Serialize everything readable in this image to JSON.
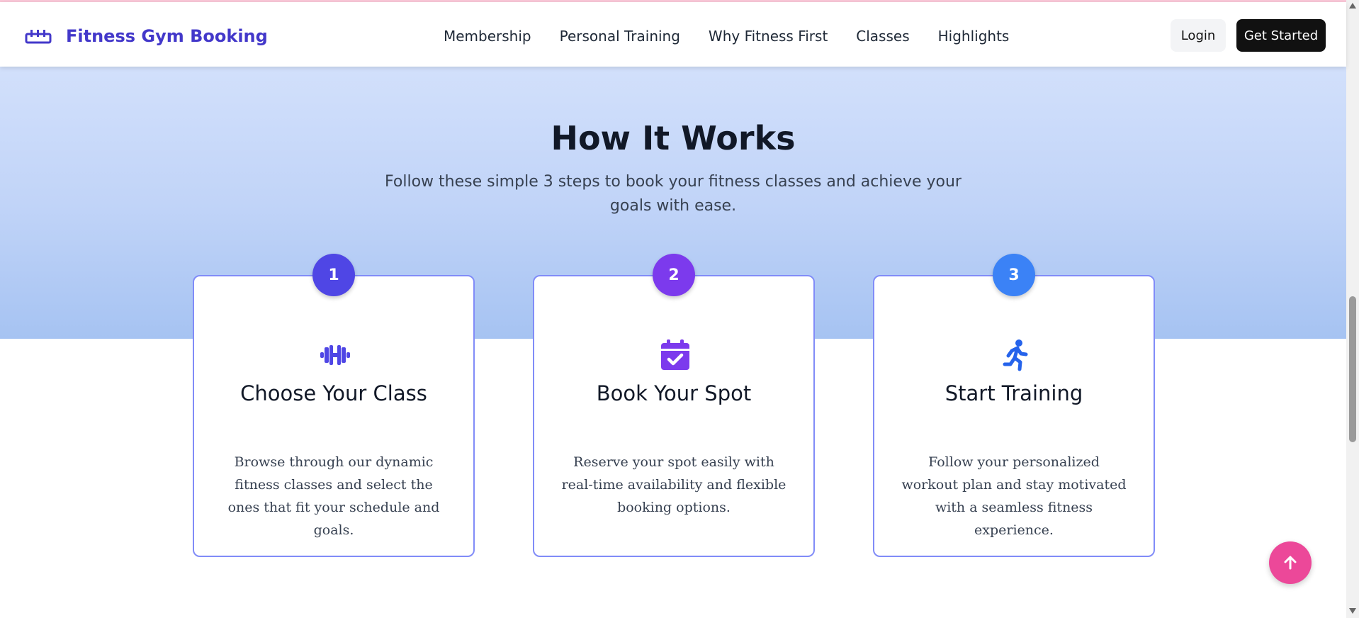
{
  "nav": {
    "brand": "Fitness Gym Booking",
    "links": [
      "Membership",
      "Personal Training",
      "Why Fitness First",
      "Classes",
      "Highlights"
    ],
    "login_label": "Login",
    "get_started_label": "Get Started"
  },
  "section": {
    "title": "How It Works",
    "subtitle": "Follow these simple 3 steps to book your fitness classes and achieve your goals with ease."
  },
  "steps": [
    {
      "number": "1",
      "icon": "dumbbell-icon",
      "title": "Choose Your Class",
      "description": "Browse through our dynamic fitness classes and select the ones that fit your schedule and goals.",
      "color": "#4f46e5"
    },
    {
      "number": "2",
      "icon": "calendar-check-icon",
      "title": "Book Your Spot",
      "description": "Reserve your spot easily with real-time availability and flexible booking options.",
      "color": "#7c3aed"
    },
    {
      "number": "3",
      "icon": "running-person-icon",
      "title": "Start Training",
      "description": "Follow your personalized workout plan and stay motivated with a seamless fitness experience.",
      "color": "#3b82f6"
    }
  ],
  "colors": {
    "brand": "#4338ca",
    "card_border": "#818cf8",
    "scroll_button": "#ec4899"
  }
}
